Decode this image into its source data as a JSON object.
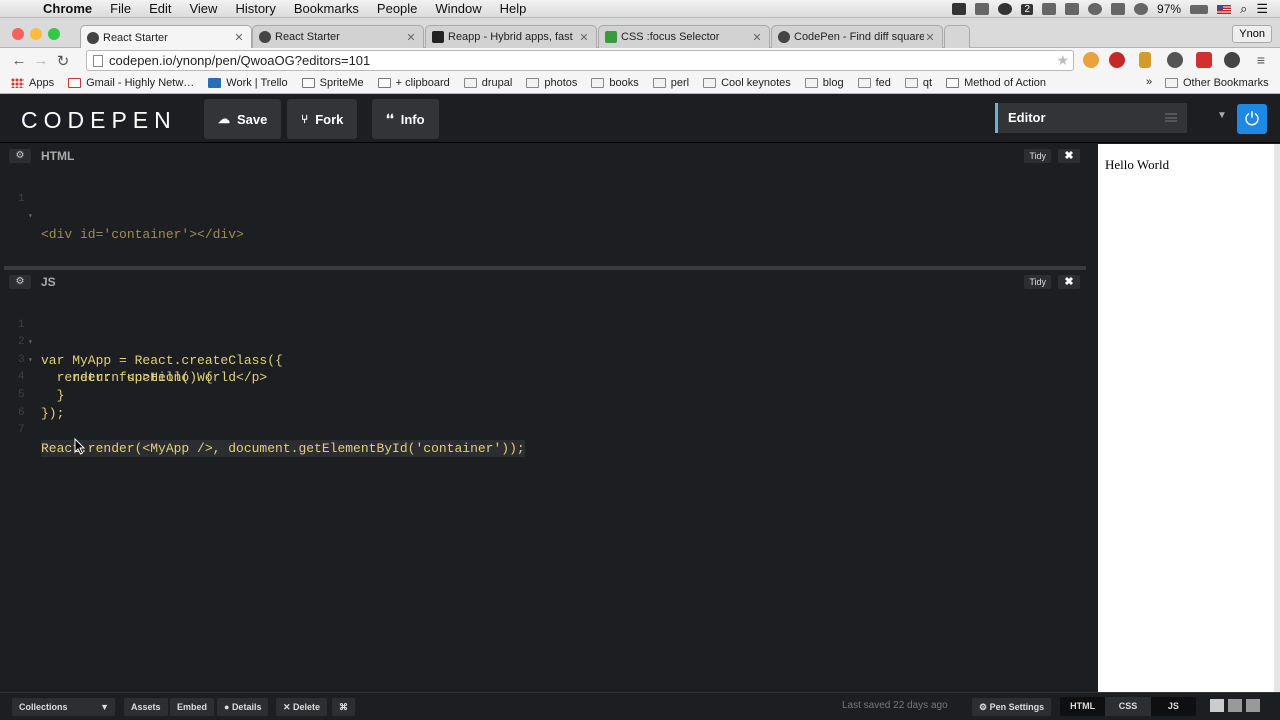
{
  "menubar": {
    "app": "Chrome",
    "items": [
      "File",
      "Edit",
      "View",
      "History",
      "Bookmarks",
      "People",
      "Window",
      "Help"
    ],
    "badge_count": "2",
    "battery": "97%"
  },
  "tabs": [
    {
      "title": "React Starter",
      "favicon_color": "#444444",
      "active": true
    },
    {
      "title": "React Starter",
      "favicon_color": "#444444",
      "active": false
    },
    {
      "title": "Reapp - Hybrid apps, fast",
      "favicon_color": "#222222",
      "active": false
    },
    {
      "title": "CSS :focus Selector",
      "favicon_color": "#3c9a3c",
      "active": false
    },
    {
      "title": "CodePen - Find diff square",
      "favicon_color": "#444444",
      "active": false
    }
  ],
  "profile_name": "Ynon",
  "url": "codepen.io/ynonp/pen/QwoaOG?editors=101",
  "bookmarks": [
    {
      "label": "Apps",
      "type": "apps"
    },
    {
      "label": "Gmail - Highly Netw…",
      "type": "gmail"
    },
    {
      "label": "Work | Trello",
      "type": "page"
    },
    {
      "label": "SpriteMe",
      "type": "page"
    },
    {
      "label": "+ clipboard",
      "type": "page"
    },
    {
      "label": "drupal",
      "type": "folder"
    },
    {
      "label": "photos",
      "type": "folder"
    },
    {
      "label": "books",
      "type": "folder"
    },
    {
      "label": "perl",
      "type": "folder"
    },
    {
      "label": "Cool keynotes",
      "type": "folder"
    },
    {
      "label": "blog",
      "type": "folder"
    },
    {
      "label": "fed",
      "type": "folder"
    },
    {
      "label": "qt",
      "type": "folder"
    },
    {
      "label": "Method of Action",
      "type": "page"
    }
  ],
  "bookmarks_more": "»",
  "other_bookmarks": "Other Bookmarks",
  "codepen": {
    "logo": "CODEPEN",
    "save": "Save",
    "fork": "Fork",
    "info": "Info",
    "view_mode": "Editor"
  },
  "html_panel": {
    "title": "HTML",
    "tidy": "Tidy",
    "close": "✖",
    "lines": [
      {
        "n": "1",
        "fold": "▾",
        "text": "<div id='container'></div>"
      }
    ]
  },
  "js_panel": {
    "title": "JS",
    "tidy": "Tidy",
    "close": "✖",
    "lines": [
      {
        "n": "1",
        "fold": "▾",
        "text": "var MyApp = React.createClass({"
      },
      {
        "n": "2",
        "fold": "▾",
        "text": "  render: function() {"
      },
      {
        "n": "3",
        "fold": "",
        "text": "    return <p>Hello World</p>"
      },
      {
        "n": "4",
        "fold": "",
        "text": "  }"
      },
      {
        "n": "5",
        "fold": "",
        "text": "});"
      },
      {
        "n": "6",
        "fold": "",
        "text": ""
      },
      {
        "n": "7",
        "fold": "",
        "text": "React.render(<MyApp />, document.getElementById('container'));"
      }
    ]
  },
  "preview_text": "Hello World",
  "footer": {
    "collections": "Collections",
    "assets": "Assets",
    "embed": "Embed",
    "details": "Details",
    "delete": "Delete",
    "shortcuts": "⌘",
    "last_saved": "Last saved 22 days ago",
    "pen_settings": "Pen Settings",
    "modes": [
      "HTML",
      "CSS",
      "JS"
    ]
  }
}
